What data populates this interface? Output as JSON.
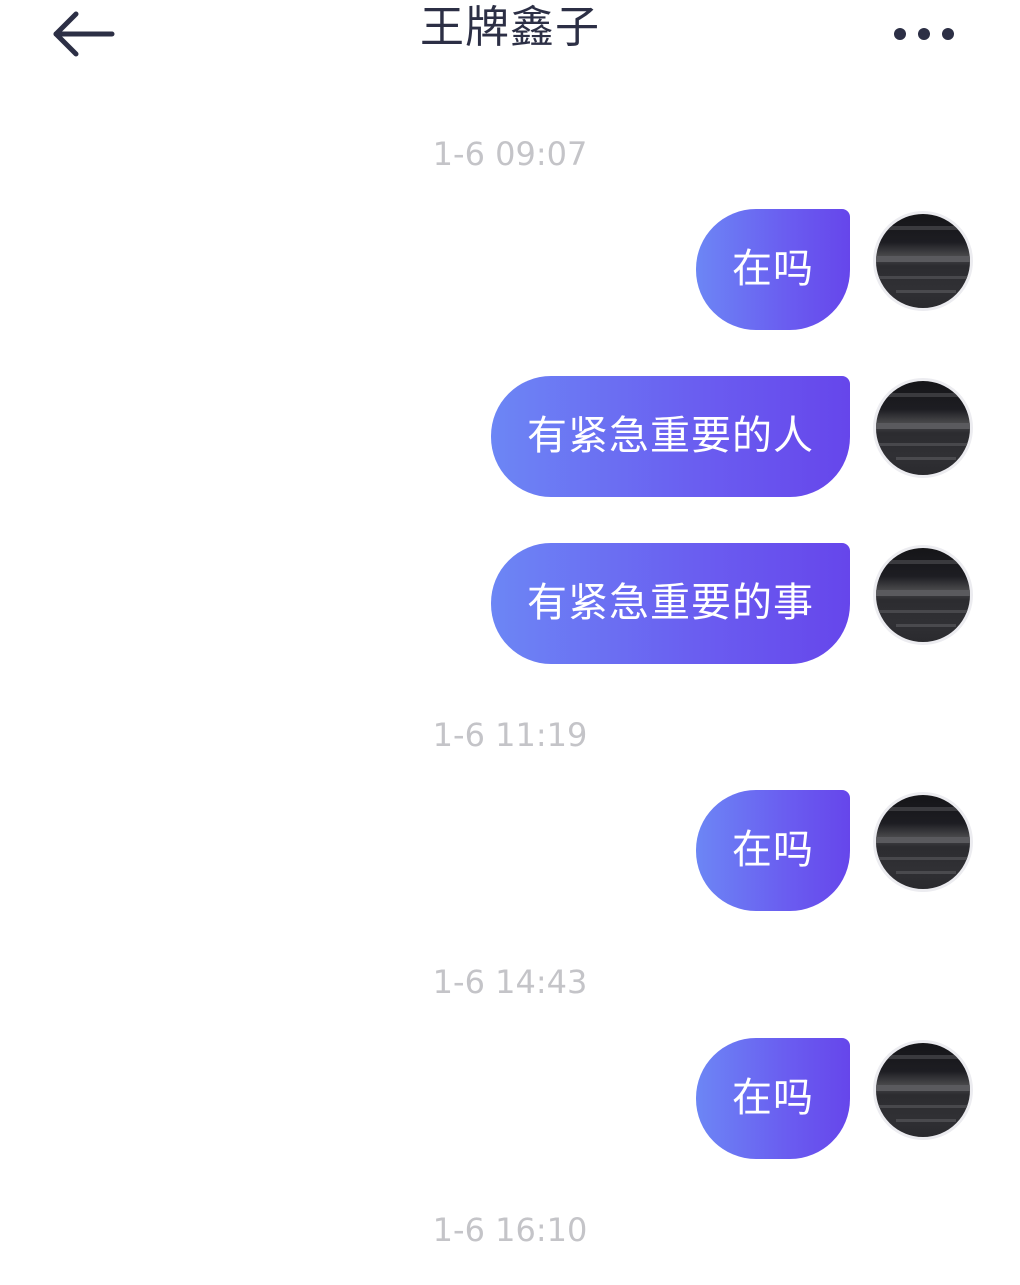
{
  "header": {
    "title": "王牌鑫子",
    "back_icon": "arrow-left-icon",
    "more_icon": "more-dots-icon"
  },
  "messages": [
    {
      "type": "time",
      "text": "1-6 09:07"
    },
    {
      "type": "msg",
      "text": "在吗"
    },
    {
      "type": "msg",
      "text": "有紧急重要的人"
    },
    {
      "type": "msg",
      "text": "有紧急重要的事"
    },
    {
      "type": "time",
      "text": "1-6 11:19"
    },
    {
      "type": "msg",
      "text": "在吗"
    },
    {
      "type": "time",
      "text": "1-6 14:43"
    },
    {
      "type": "msg",
      "text": "在吗"
    },
    {
      "type": "time",
      "text": "1-6 16:10"
    }
  ],
  "colors": {
    "bubble_start": "#6c86f5",
    "bubble_end": "#6646eb",
    "timestamp": "#c4c4c8",
    "title": "#2c2f45"
  }
}
